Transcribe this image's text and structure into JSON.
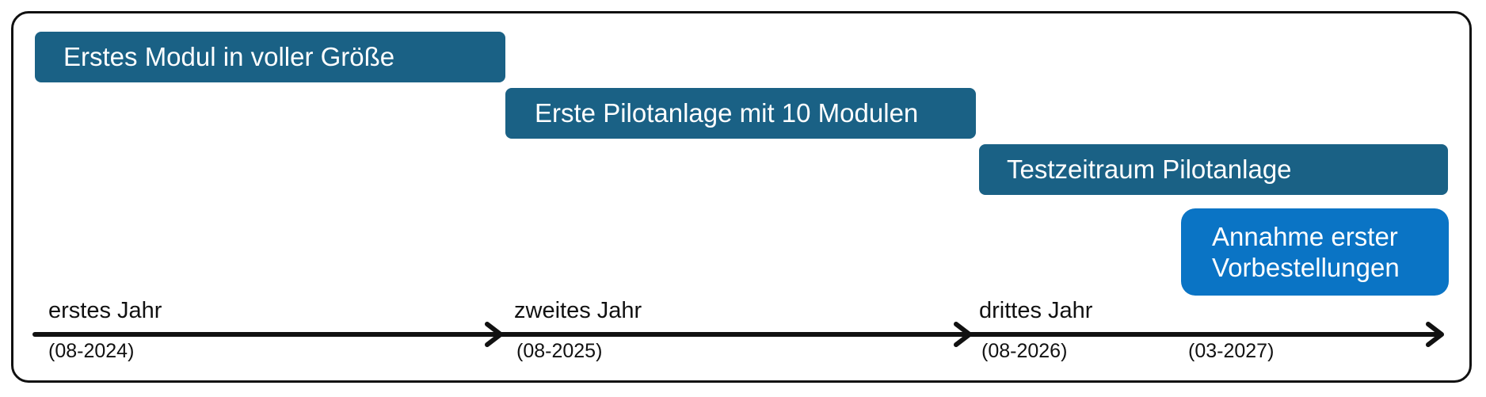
{
  "tasks": [
    {
      "label": "Erstes Modul in voller Größe",
      "color": "#1a6185"
    },
    {
      "label": "Erste Pilotanlage mit 10 Modulen",
      "color": "#1a6185"
    },
    {
      "label": "Testzeitraum Pilotanlage",
      "color": "#1a6185"
    },
    {
      "label": "Annahme erster Vorbestellungen",
      "color": "#0a74c5"
    }
  ],
  "timeline": {
    "years": [
      "erstes Jahr",
      "zweites Jahr",
      "drittes Jahr"
    ],
    "dates": [
      "(08-2024)",
      "(08-2025)",
      "(08-2026)",
      "(03-2027)"
    ]
  },
  "colors": {
    "bar": "#1a6185",
    "highlight": "#0a74c5",
    "axis": "#111111"
  }
}
